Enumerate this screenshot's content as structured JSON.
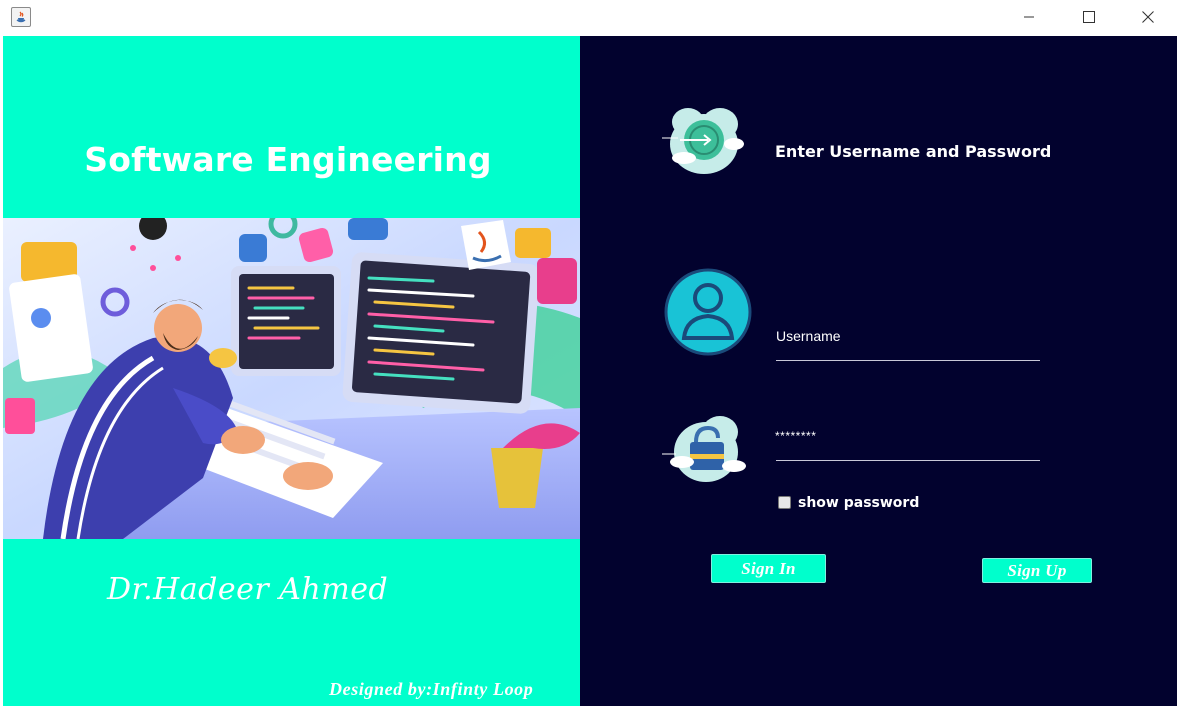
{
  "window": {
    "minimize_symbol": "—",
    "maximize_symbol": "☐",
    "close_symbol": "✕"
  },
  "left_panel": {
    "title": "Software Engineering",
    "author": "Dr.Hadeer Ahmed",
    "designed_by": "Designed by:Infinty Loop"
  },
  "login": {
    "header": "Enter Username and Password",
    "username_label": "Username",
    "password_value": "********",
    "show_password_label": "show password",
    "show_password_checked": false,
    "sign_in_label": "Sign In",
    "sign_up_label": "Sign Up"
  },
  "colors": {
    "accent": "#00ffcc",
    "dark_background": "#02022e",
    "text": "#ffffff"
  },
  "icons": [
    "java-app-icon",
    "minimize-icon",
    "maximize-icon",
    "close-icon",
    "login-cloud-icon",
    "user-avatar-icon",
    "lock-cloud-icon"
  ]
}
